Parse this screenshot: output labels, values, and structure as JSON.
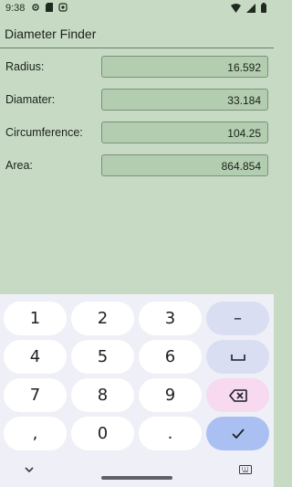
{
  "status_bar": {
    "time": "9:38"
  },
  "app": {
    "title": "Diameter Finder"
  },
  "fields": [
    {
      "label": "Radius:",
      "value": "16.592"
    },
    {
      "label": "Diamater:",
      "value": "33.184"
    },
    {
      "label": "Circumference:",
      "value": "104.25"
    },
    {
      "label": "Area:",
      "value": "864.854"
    }
  ],
  "keyboard": {
    "keys": [
      "1",
      "2",
      "3",
      "–",
      "4",
      "5",
      "6",
      "␣",
      "7",
      "8",
      "9",
      "⌫",
      ",",
      "0",
      ".",
      "✓"
    ]
  },
  "colors": {
    "background": "#c7dbc4",
    "field": "#b3cdb0",
    "keyboard": "#eff0f7",
    "done_key": "#aac0f2",
    "delete_key": "#f7d9f0"
  }
}
